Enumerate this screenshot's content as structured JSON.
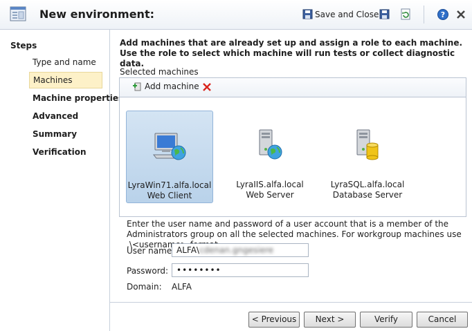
{
  "header": {
    "title": "New environment:",
    "save_close_label": "Save and Close"
  },
  "steps": {
    "title": "Steps",
    "items": [
      {
        "label": "Type and name"
      },
      {
        "label": "Machines"
      },
      {
        "label": "Machine properties"
      },
      {
        "label": "Advanced"
      },
      {
        "label": "Summary"
      },
      {
        "label": "Verification"
      }
    ]
  },
  "main": {
    "intro": "Add machines that are already set up and assign a role to each machine. Use the role to select which machine will run tests or collect diagnostic data.",
    "selected_machines_label": "Selected machines",
    "add_machine_label": "Add machine",
    "machines": [
      {
        "name": "LyraWin71.alfa.local",
        "role": "Web Client"
      },
      {
        "name": "LyraIIS.alfa.local",
        "role": "Web Server"
      },
      {
        "name": "LyraSQL.alfa.local",
        "role": "Database Server"
      }
    ],
    "credentials_note": "Enter the user name and password of a user account that is a member of the Administrators group on all the selected machines. For workgroup machines use .\\<username> format.",
    "user_name_label": "User name:",
    "user_name_value": "ALFA\\",
    "user_name_blurred": "cdenan.gngesiere",
    "password_label": "Password:",
    "password_value": "••••••••",
    "domain_label": "Domain:",
    "domain_value": "ALFA"
  },
  "buttons": {
    "previous": "< Previous",
    "next": "Next >",
    "verify": "Verify",
    "cancel": "Cancel"
  }
}
